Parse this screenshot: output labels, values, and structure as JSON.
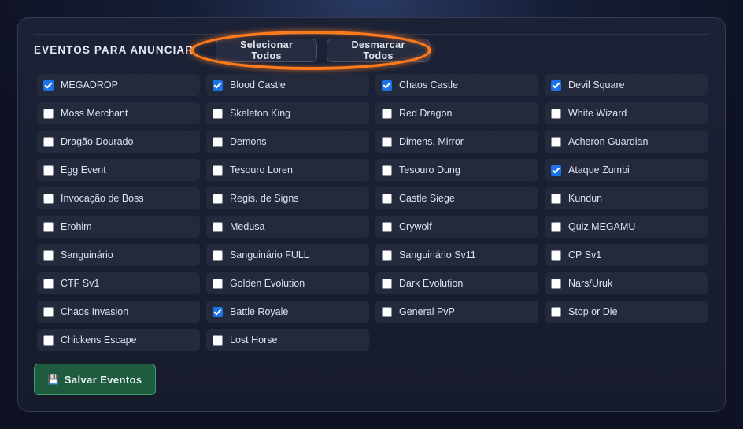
{
  "section": {
    "title": "EVENTOS PARA ANUNCIAR",
    "select_all_label": "Selecionar Todos",
    "unselect_all_label": "Desmarcar Todos"
  },
  "events": [
    {
      "label": "MEGADROP",
      "checked": true
    },
    {
      "label": "Blood Castle",
      "checked": true
    },
    {
      "label": "Chaos Castle",
      "checked": true
    },
    {
      "label": "Devil Square",
      "checked": true
    },
    {
      "label": "Moss Merchant",
      "checked": false
    },
    {
      "label": "Skeleton King",
      "checked": false
    },
    {
      "label": "Red Dragon",
      "checked": false
    },
    {
      "label": "White Wizard",
      "checked": false
    },
    {
      "label": "Dragão Dourado",
      "checked": false
    },
    {
      "label": "Demons",
      "checked": false
    },
    {
      "label": "Dimens. Mirror",
      "checked": false
    },
    {
      "label": "Acheron Guardian",
      "checked": false
    },
    {
      "label": "Egg Event",
      "checked": false
    },
    {
      "label": "Tesouro Loren",
      "checked": false
    },
    {
      "label": "Tesouro Dung",
      "checked": false
    },
    {
      "label": "Ataque Zumbi",
      "checked": true
    },
    {
      "label": "Invocação de Boss",
      "checked": false
    },
    {
      "label": "Regis. de Signs",
      "checked": false
    },
    {
      "label": "Castle Siege",
      "checked": false
    },
    {
      "label": "Kundun",
      "checked": false
    },
    {
      "label": "Erohim",
      "checked": false
    },
    {
      "label": "Medusa",
      "checked": false
    },
    {
      "label": "Crywolf",
      "checked": false
    },
    {
      "label": "Quiz MEGAMU",
      "checked": false
    },
    {
      "label": "Sanguinário",
      "checked": false
    },
    {
      "label": "Sanguinário FULL",
      "checked": false
    },
    {
      "label": "Sanguinário Sv11",
      "checked": false
    },
    {
      "label": "CP Sv1",
      "checked": false
    },
    {
      "label": "CTF Sv1",
      "checked": false
    },
    {
      "label": "Golden Evolution",
      "checked": false
    },
    {
      "label": "Dark Evolution",
      "checked": false
    },
    {
      "label": "Nars/Uruk",
      "checked": false
    },
    {
      "label": "Chaos Invasion",
      "checked": false
    },
    {
      "label": "Battle Royale",
      "checked": true
    },
    {
      "label": "General PvP",
      "checked": false
    },
    {
      "label": "Stop or Die",
      "checked": false
    },
    {
      "label": "Chickens Escape",
      "checked": false
    },
    {
      "label": "Lost Horse",
      "checked": false
    }
  ],
  "save": {
    "icon": "floppy-disk-icon",
    "label": "Salvar Eventos"
  },
  "colors": {
    "highlight_ring": "#ff7a1a",
    "checkbox_checked": "#1a73e8",
    "save_button": "#1f5c3f"
  }
}
